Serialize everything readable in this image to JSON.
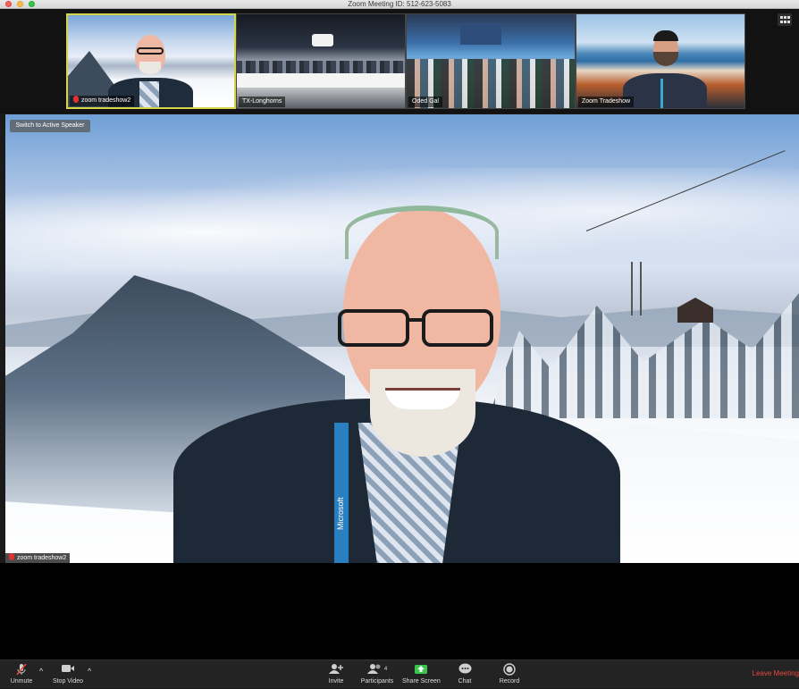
{
  "window": {
    "title": "Zoom Meeting ID: 512-623-5083"
  },
  "gallery": [
    {
      "name": "zoom tradeshow2",
      "muted": true,
      "active": true
    },
    {
      "name": "TX-Longhorns",
      "muted": false,
      "active": false
    },
    {
      "name": "Oded Gal",
      "muted": false,
      "active": false
    },
    {
      "name": "Zoom Tradeshow",
      "muted": false,
      "active": false
    }
  ],
  "main": {
    "switch_button": "Switch to Active Speaker",
    "speaker_name": "zoom tradeshow2",
    "lanyard_text": "Microsoft"
  },
  "toolbar": {
    "unmute": "Unmute",
    "stop_video": "Stop Video",
    "invite": "Invite",
    "participants": "Participants",
    "participant_count": "4",
    "share": "Share Screen",
    "chat": "Chat",
    "record": "Record",
    "leave": "Leave Meeting"
  },
  "colors": {
    "accent_active_border": "#d6d548",
    "share_green": "#37c44f",
    "leave_red": "#e8483e"
  }
}
